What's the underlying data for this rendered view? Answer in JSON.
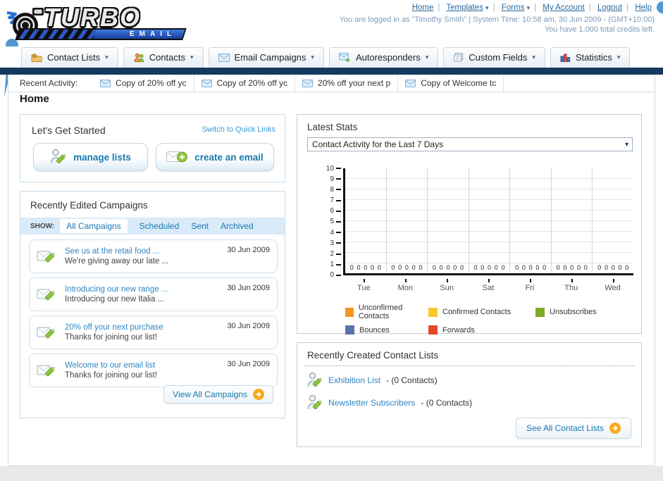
{
  "logo": {
    "title": "TURBO",
    "subtitle": "EMAIL"
  },
  "icons": {
    "caret_glyph": "▾"
  },
  "header": {
    "nav": [
      {
        "label": "Home",
        "caret": false
      },
      {
        "label": "Templates",
        "caret": true
      },
      {
        "label": "Forms",
        "caret": true
      },
      {
        "label": "My Account",
        "caret": false
      },
      {
        "label": "Logout",
        "caret": false
      },
      {
        "label": "Help",
        "caret": false
      }
    ],
    "user_info": "You are logged in as \"Timothy Smith\" | System Time: 10:58 am, 30 Jun 2009 - (GMT+10:00)",
    "credits": "You have 1,000 total credits left."
  },
  "tabs": [
    {
      "label": "Contact Lists",
      "icon": "folder-user-icon"
    },
    {
      "label": "Contacts",
      "icon": "contacts-icon"
    },
    {
      "label": "Email Campaigns",
      "icon": "envelope-icon"
    },
    {
      "label": "Autoresponders",
      "icon": "envelope-arrow-icon"
    },
    {
      "label": "Custom Fields",
      "icon": "pages-icon"
    },
    {
      "label": "Statistics",
      "icon": "bar-chart-icon"
    }
  ],
  "recent_activity": {
    "label": "Recent Activity:",
    "items": [
      "Copy of 20% off yc",
      "Copy of 20% off yc",
      "20% off your next p",
      "Copy of Welcome tc"
    ]
  },
  "page_title": "Home",
  "get_started": {
    "title": "Let's Get Started",
    "switch_link": "Switch to Quick Links",
    "manage_button": "manage lists",
    "create_button": "create an email"
  },
  "campaigns": {
    "title": "Recently Edited Campaigns",
    "show_label": "SHOW:",
    "filters": [
      "All Campaigns",
      "Scheduled",
      "Sent",
      "Archived"
    ],
    "active_filter": "All Campaigns",
    "rows": [
      {
        "title": "See us at the retail food ...",
        "subtitle": "We're giving away our late ...",
        "date": "30 Jun 2009"
      },
      {
        "title": "Introducing our new range ...",
        "subtitle": "Introducing our new Italia ...",
        "date": "30 Jun 2009"
      },
      {
        "title": "20% off your next purchase",
        "subtitle": "Thanks for joining our list!",
        "date": "30 Jun 2009"
      },
      {
        "title": "Welcome to our email list",
        "subtitle": "Thanks for joining our list!",
        "date": "30 Jun 2009"
      }
    ],
    "view_all": "View All Campaigns"
  },
  "stats": {
    "title": "Latest Stats",
    "dropdown_value": "Contact Activity for the Last 7 Days"
  },
  "chart_data": {
    "type": "bar",
    "title": "Contact Activity for the Last 7 Days",
    "categories": [
      "Tue",
      "Mon",
      "Sun",
      "Sat",
      "Fri",
      "Thu",
      "Wed"
    ],
    "series": [
      {
        "name": "Unconfirmed Contacts",
        "color": "#f7941e",
        "values": [
          0,
          0,
          0,
          0,
          0,
          0,
          0
        ]
      },
      {
        "name": "Confirmed Contacts",
        "color": "#fcc62f",
        "values": [
          0,
          0,
          0,
          0,
          0,
          0,
          0
        ]
      },
      {
        "name": "Unsubscribes",
        "color": "#7caa27",
        "values": [
          0,
          0,
          0,
          0,
          0,
          0,
          0
        ]
      },
      {
        "name": "Bounces",
        "color": "#5874a7",
        "values": [
          0,
          0,
          0,
          0,
          0,
          0,
          0
        ]
      },
      {
        "name": "Forwards",
        "color": "#e24a28",
        "values": [
          0,
          0,
          0,
          0,
          0,
          0,
          0
        ]
      }
    ],
    "ylim": [
      0,
      10
    ],
    "yticks": [
      0,
      1,
      2,
      3,
      4,
      5,
      6,
      7,
      8,
      9,
      10
    ],
    "grid": true,
    "legend_position": "bottom",
    "value_labels_shown": true
  },
  "contact_lists": {
    "title": "Recently Created Contact Lists",
    "items": [
      {
        "name": "Exhibition List",
        "detail": "- (0 Contacts)"
      },
      {
        "name": "Newsletter Subscribers",
        "detail": "- (0 Contacts)"
      }
    ],
    "see_all": "See All Contact Lists"
  }
}
